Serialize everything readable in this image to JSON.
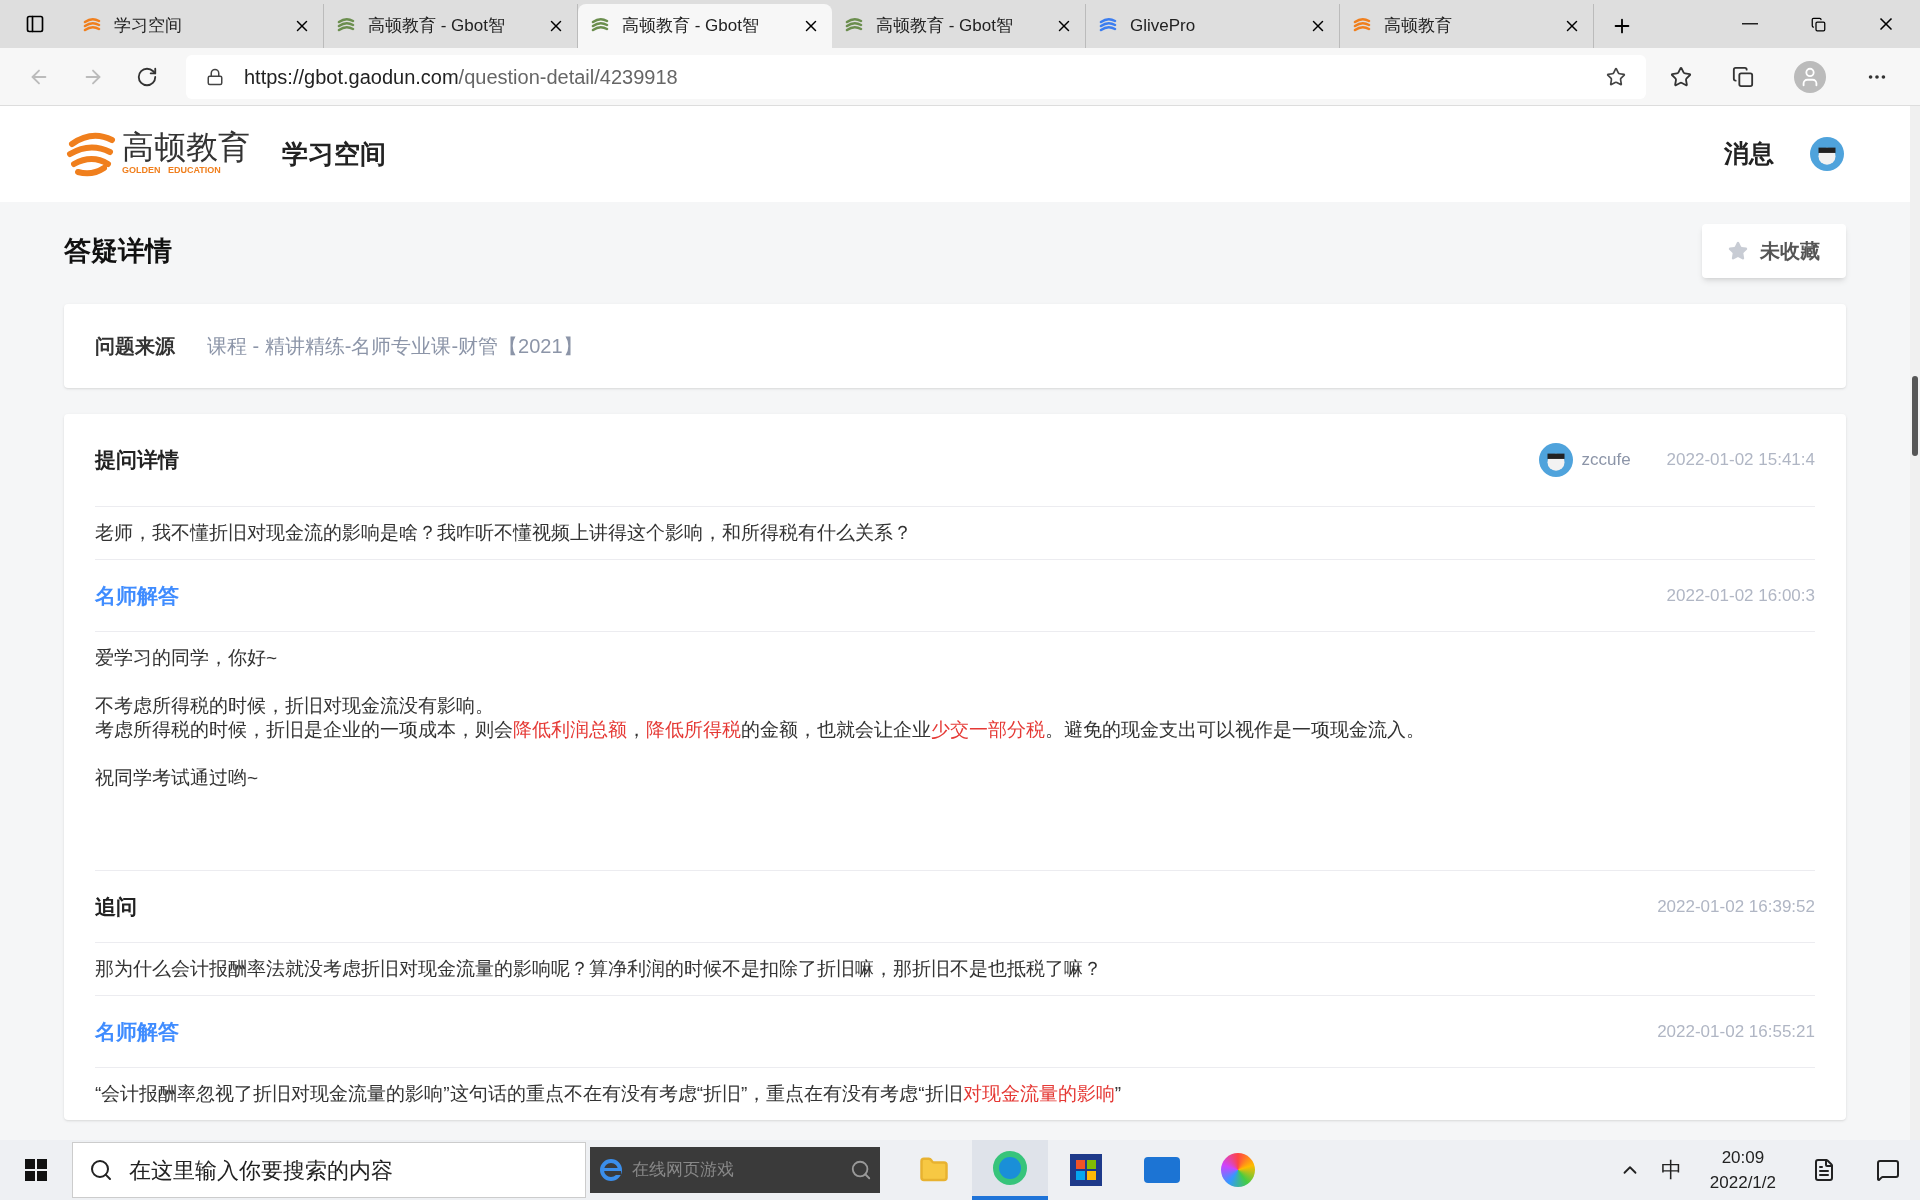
{
  "browser": {
    "tabs": [
      {
        "title": "学习空间",
        "selected": false,
        "kind": "orange"
      },
      {
        "title": "高顿教育 - Gbot智",
        "selected": false,
        "kind": "green"
      },
      {
        "title": "高顿教育 - Gbot智",
        "selected": true,
        "kind": "green"
      },
      {
        "title": "高顿教育 - Gbot智",
        "selected": false,
        "kind": "green"
      },
      {
        "title": "GlivePro",
        "selected": false,
        "kind": "blue"
      },
      {
        "title": "高顿教育",
        "selected": false,
        "kind": "orange"
      }
    ],
    "url": {
      "host": "https://gbot.gaodun.com",
      "path": "/question-detail/4239918"
    }
  },
  "site": {
    "logo": "高顿教育",
    "logo_sub": "GOLDEN   EDUCATION",
    "nav": "学习空间",
    "messages": "消息"
  },
  "page": {
    "title": "答疑详情",
    "favorite": {
      "label": "未收藏",
      "favorited": false
    }
  },
  "source": {
    "label": "问题来源",
    "value": "课程 - 精讲精练-名师专业课-财管【2021】"
  },
  "thread": [
    {
      "kind": "question",
      "title": "提问详情",
      "author": "zccufe",
      "time": "2022-01-02 15:41:4",
      "blocks": [
        [
          [
            {
              "text": "老师，我不懂折旧对现金流的影响是啥？我咋听不懂视频上讲得这个影响，和所得税有什么关系？",
              "highlight": false
            }
          ]
        ]
      ]
    },
    {
      "kind": "answer",
      "title": "名师解答",
      "time": "2022-01-02 16:00:3",
      "blocks": [
        [
          [
            {
              "text": "爱学习的同学，你好~",
              "highlight": false
            }
          ]
        ],
        [
          [
            {
              "text": "不考虑所得税的时候，折旧对现金流没有影响。",
              "highlight": false
            }
          ],
          [
            {
              "text": "考虑所得税的时候，折旧是企业的一项成本，则会",
              "highlight": false
            },
            {
              "text": "降低利润总额",
              "highlight": true
            },
            {
              "text": "，",
              "highlight": false
            },
            {
              "text": "降低所得税",
              "highlight": true
            },
            {
              "text": "的金额，也就会让企业",
              "highlight": false
            },
            {
              "text": "少交一部分税",
              "highlight": true
            },
            {
              "text": "。避免的现金支出可以视作是一项现金流入。",
              "highlight": false
            }
          ]
        ],
        [
          [
            {
              "text": "祝同学考试通过哟~",
              "highlight": false
            }
          ]
        ]
      ]
    },
    {
      "kind": "followup",
      "title": "追问",
      "time": "2022-01-02 16:39:52",
      "blocks": [
        [
          [
            {
              "text": "那为什么会计报酬率法就没考虑折旧对现金流量的影响呢？算净利润的时候不是扣除了折旧嘛，那折旧不是也抵税了嘛？",
              "highlight": false
            }
          ]
        ]
      ]
    },
    {
      "kind": "answer",
      "title": "名师解答",
      "time": "2022-01-02 16:55:21",
      "blocks": [
        [
          [
            {
              "text": "“会计报酬率忽视了折旧对现金流量的影响”这句话的重点不在有没有考虑“折旧”，重点在有没有考虑“折旧",
              "highlight": false
            },
            {
              "text": "对现金流量的影响",
              "highlight": true
            },
            {
              "text": "”",
              "highlight": false
            }
          ]
        ]
      ]
    }
  ],
  "taskbar": {
    "search_placeholder": "在这里输入你要搜索的内容",
    "browser_search_placeholder": "在线网页游戏",
    "ime": "中",
    "time": "20:09",
    "date": "2022/1/2"
  }
}
